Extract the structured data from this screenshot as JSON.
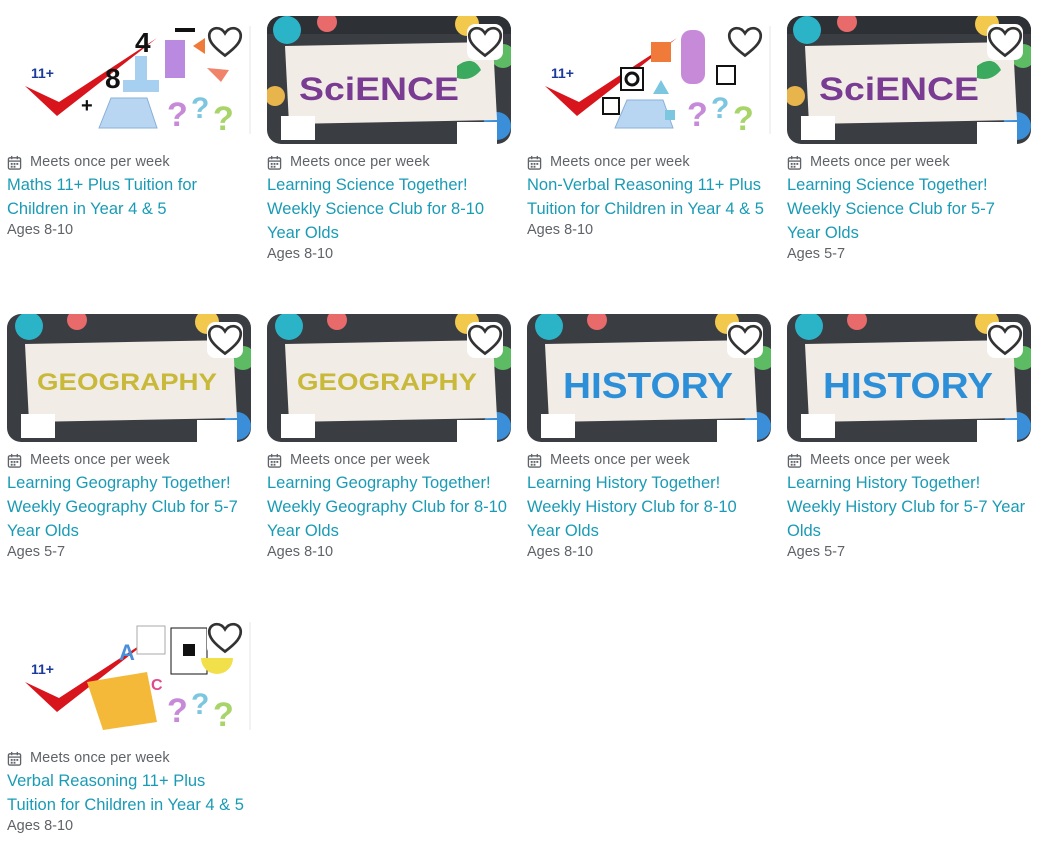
{
  "cards": [
    {
      "image": "maths-11-plus",
      "meets": "Meets once per week",
      "title": "Maths 11+ Plus Tuition for Children in Year 4 & 5",
      "ages": "Ages 8-10"
    },
    {
      "image": "science",
      "meets": "Meets once per week",
      "title": "Learning Science Together! Weekly Science Club for 8-10 Year Olds",
      "ages": "Ages 8-10"
    },
    {
      "image": "non-verbal-11-plus",
      "meets": "Meets once per week",
      "title": "Non-Verbal Reasoning 11+ Plus Tuition for Children in Year 4 & 5",
      "ages": "Ages 8-10"
    },
    {
      "image": "science",
      "meets": "Meets once per week",
      "title": "Learning Science Together! Weekly Science Club for 5-7 Year Olds",
      "ages": "Ages 5-7"
    },
    {
      "image": "geography",
      "meets": "Meets once per week",
      "title": "Learning Geography Together! Weekly Geography Club for 5-7 Year Olds",
      "ages": "Ages 5-7"
    },
    {
      "image": "geography",
      "meets": "Meets once per week",
      "title": "Learning Geography Together! Weekly Geography Club for 8-10 Year Olds",
      "ages": "Ages 8-10"
    },
    {
      "image": "history",
      "meets": "Meets once per week",
      "title": "Learning History Together! Weekly History Club for 8-10 Year Olds",
      "ages": "Ages 8-10"
    },
    {
      "image": "history",
      "meets": "Meets once per week",
      "title": "Learning History Together! Weekly History Club for 5-7 Year Olds",
      "ages": "Ages 5-7"
    },
    {
      "image": "verbal-11-plus",
      "meets": "Meets once per week",
      "title": "Verbal Reasoning 11+ Plus Tuition for Children in Year 4 & 5",
      "ages": "Ages 8-10"
    }
  ],
  "image_text": {
    "eleven_plus": "11+",
    "science": "SciENCE",
    "geography": "GEOGRAPHY",
    "history": "HISTORY"
  },
  "colors": {
    "link": "#1a9bb5",
    "meta": "#5f6368"
  }
}
